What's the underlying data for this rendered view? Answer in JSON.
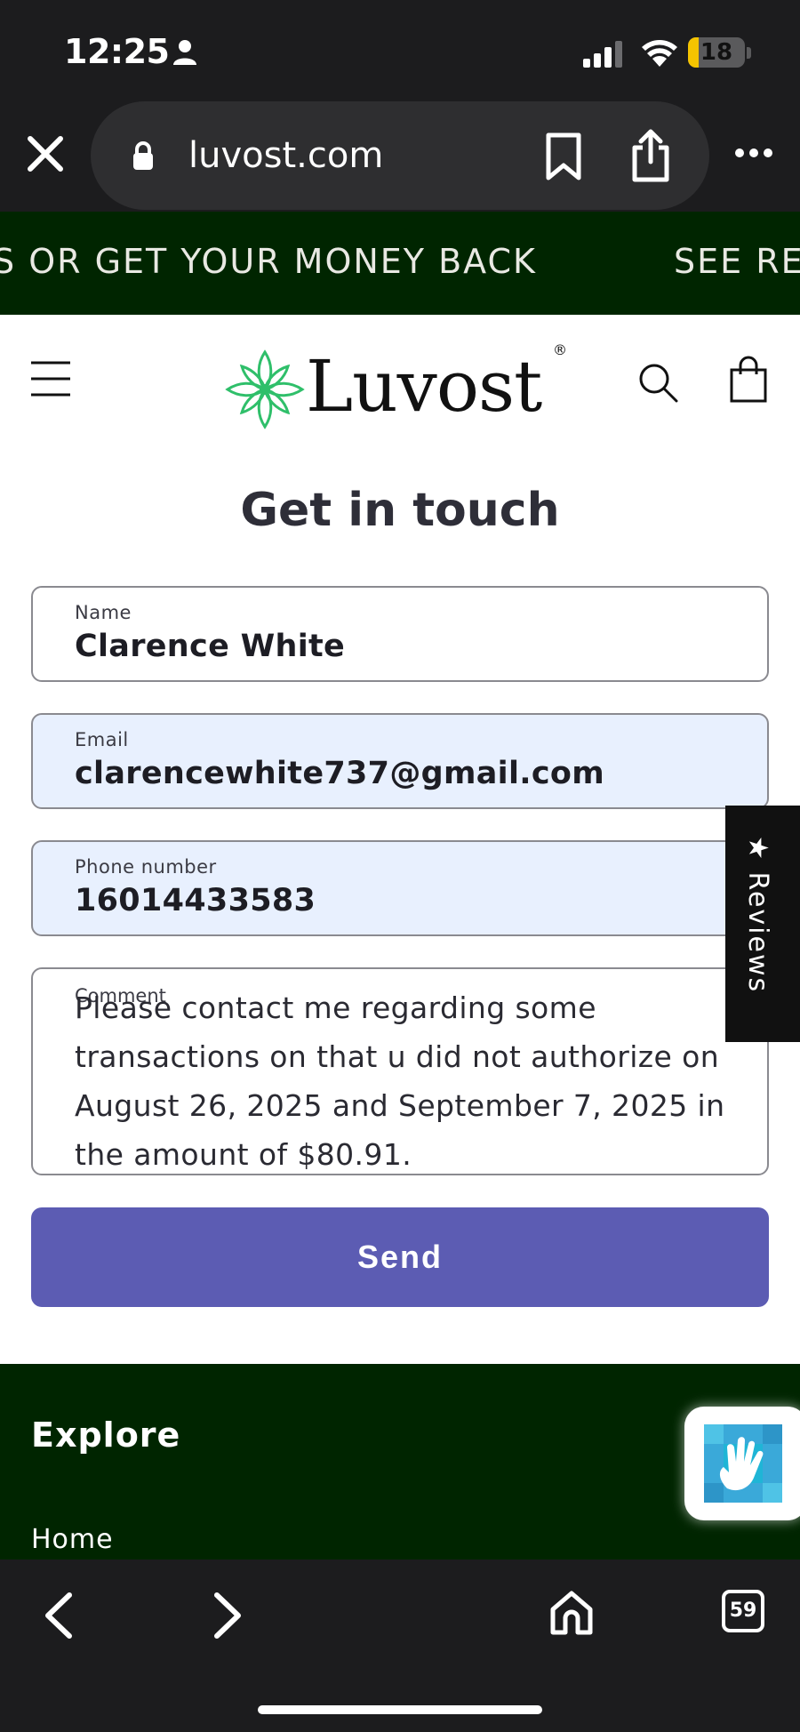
{
  "status_bar": {
    "time": "12:25",
    "battery_level": "18",
    "icons": [
      "person-icon",
      "signal-icon",
      "wifi-icon",
      "battery-icon"
    ]
  },
  "browser": {
    "url": "luvost.com",
    "icons": [
      "close-icon",
      "lock-icon",
      "bookmark-icon",
      "share-icon",
      "more-icon"
    ]
  },
  "banner": {
    "text_1": "S OR GET YOUR MONEY BACK",
    "text_2": "SEE RE"
  },
  "header": {
    "logo_text": "Luvost",
    "logo_mark": "®",
    "icons": [
      "menu-icon",
      "leaf-logo-icon",
      "search-icon",
      "cart-icon"
    ]
  },
  "form": {
    "title": "Get in touch",
    "name": {
      "label": "Name",
      "value": "Clarence White"
    },
    "email": {
      "label": "Email",
      "value": "clarencewhite737@gmail.com"
    },
    "phone": {
      "label": "Phone number",
      "value": "16014433583"
    },
    "comment": {
      "label": "Comment",
      "value": "Please contact me regarding some transactions on that u did not authorize on August 26, 2025 and September 7, 2025 in the amount of $80.91."
    },
    "send_label": "Send"
  },
  "reviews_tab": {
    "star": "★",
    "label": "Reviews"
  },
  "footer": {
    "heading": "Explore",
    "links": [
      "Home"
    ]
  },
  "toolbar": {
    "tab_count": "59",
    "icons": [
      "back-icon",
      "forward-icon",
      "home-icon",
      "tabs-icon"
    ]
  },
  "colors": {
    "banner_bg": "#002500",
    "send_button": "#5c5cb3",
    "autofill_bg": "#e8f0fe",
    "chrome_bg": "#1c1c1e",
    "battery_low": "#f5c400",
    "logo_leaf": "#2fbf6a"
  }
}
